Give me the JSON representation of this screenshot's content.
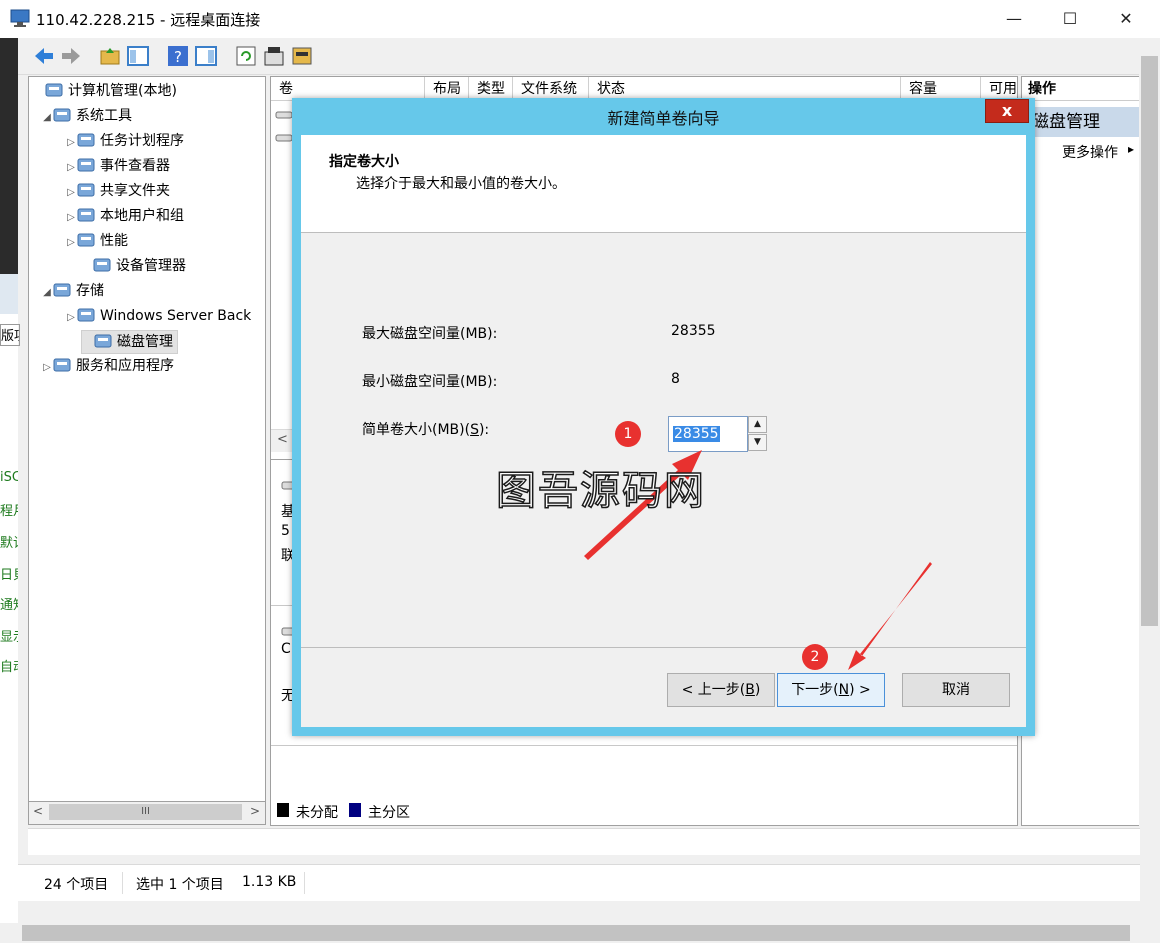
{
  "window": {
    "title": "110.42.228.215 - 远程桌面连接",
    "minimize": "—",
    "maximize": "☐",
    "close": "✕"
  },
  "host_edge": {
    "label_top": "版项",
    "lines": [
      "iSC",
      "程月",
      "默记",
      "日貝",
      "通知",
      "显示",
      "自动"
    ]
  },
  "tree": {
    "items": [
      {
        "label": "计算机管理(本地)",
        "expander": "",
        "icon": "computer-management-icon"
      },
      {
        "label": "系统工具",
        "expander": "◢",
        "icon": "system-tools-icon"
      },
      {
        "label": "任务计划程序",
        "expander": "▷",
        "icon": "task-scheduler-icon"
      },
      {
        "label": "事件查看器",
        "expander": "▷",
        "icon": "event-viewer-icon"
      },
      {
        "label": "共享文件夹",
        "expander": "▷",
        "icon": "shared-folder-icon"
      },
      {
        "label": "本地用户和组",
        "expander": "▷",
        "icon": "local-users-icon"
      },
      {
        "label": "性能",
        "expander": "▷",
        "icon": "performance-icon"
      },
      {
        "label": "设备管理器",
        "expander": "",
        "icon": "device-manager-icon"
      },
      {
        "label": "存储",
        "expander": "◢",
        "icon": "storage-icon"
      },
      {
        "label": "Windows Server Back",
        "expander": "▷",
        "icon": "windows-backup-icon"
      },
      {
        "label": "磁盘管理",
        "expander": "",
        "icon": "disk-management-icon"
      },
      {
        "label": "服务和应用程序",
        "expander": "▷",
        "icon": "services-icon"
      }
    ],
    "hscroll_thumb": "III",
    "scroll_left": "<",
    "scroll_right": ">"
  },
  "volume_table": {
    "columns": [
      "卷",
      "布局",
      "类型",
      "文件系统",
      "状态",
      "容量",
      "可用"
    ],
    "scroll_left": "<"
  },
  "disk_area": {
    "disk0_lines": [
      "基",
      "5",
      "联"
    ],
    "disk1_lines": [
      "C",
      "无"
    ],
    "legend": [
      {
        "label": "未分配",
        "color": "#000000"
      },
      {
        "label": "主分区",
        "color": "#000080"
      }
    ]
  },
  "actions": {
    "header": "操作",
    "section": "磁盘管理",
    "more": "更多操作",
    "more_arrow": "▸"
  },
  "status": {
    "count": "24 个项目",
    "selected": "选中 1 个项目",
    "size": "1.13 KB"
  },
  "dialog": {
    "title": "新建简单卷向导",
    "close": "x",
    "heading": "指定卷大小",
    "subheading": "选择介于最大和最小值的卷大小。",
    "max_label": "最大磁盘空间量(MB):",
    "max_value": "28355",
    "min_label": "最小磁盘空间量(MB):",
    "min_value": "8",
    "size_label_prefix": "简单卷大小(MB)(",
    "size_label_key": "S",
    "size_label_suffix": "):",
    "size_value": "28355",
    "spin_up": "▲",
    "spin_down": "▼",
    "back_prefix": "< 上一步(",
    "back_key": "B",
    "back_suffix": ")",
    "next_prefix": "下一步(",
    "next_key": "N",
    "next_suffix": ") >",
    "cancel": "取消"
  },
  "annotations": {
    "badge1": "1",
    "badge2": "2",
    "arrow_color": "#e8312f"
  },
  "watermark": {
    "text": "图吾源码网"
  }
}
